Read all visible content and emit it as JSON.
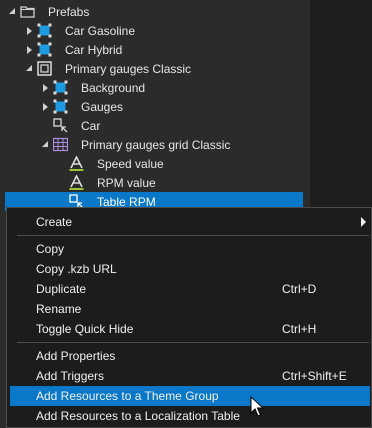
{
  "tree": {
    "items": [
      {
        "label": "Prefabs",
        "icon": "folder-icon",
        "expander": "expanded"
      },
      {
        "label": "Car Gasoline",
        "icon": "prefab-icon",
        "expander": "collapsed"
      },
      {
        "label": "Car Hybrid",
        "icon": "prefab-icon",
        "expander": "collapsed"
      },
      {
        "label": "Primary gauges Classic",
        "icon": "node-icon",
        "expander": "expanded"
      },
      {
        "label": "Background",
        "icon": "prefab-icon",
        "expander": "collapsed"
      },
      {
        "label": "Gauges",
        "icon": "prefab-icon",
        "expander": "collapsed"
      },
      {
        "label": "Car",
        "icon": "prefab-instance-icon",
        "expander": "none"
      },
      {
        "label": "Primary gauges grid Classic",
        "icon": "grid-layout-icon",
        "expander": "expanded"
      },
      {
        "label": "Speed value",
        "icon": "text-block-icon",
        "expander": "none"
      },
      {
        "label": "RPM value",
        "icon": "text-block-icon",
        "expander": "none"
      },
      {
        "label": "Table RPM",
        "icon": "prefab-instance-icon",
        "expander": "none",
        "selected": true
      }
    ]
  },
  "menu": {
    "items": [
      {
        "label": "Create",
        "shortcut": "",
        "submenu": true
      },
      {
        "label": "Copy",
        "shortcut": ""
      },
      {
        "label": "Copy .kzb URL",
        "shortcut": ""
      },
      {
        "label": "Duplicate",
        "shortcut": "Ctrl+D"
      },
      {
        "label": "Rename",
        "shortcut": ""
      },
      {
        "label": "Toggle Quick Hide",
        "shortcut": "Ctrl+H"
      },
      {
        "label": "Add Properties",
        "shortcut": ""
      },
      {
        "label": "Add Triggers",
        "shortcut": "Ctrl+Shift+E"
      },
      {
        "label": "Add Resources to a Theme Group",
        "shortcut": "",
        "highlighted": true
      },
      {
        "label": "Add Resources to a Localization Table",
        "shortcut": ""
      }
    ]
  },
  "colors": {
    "selection": "#0a78c8",
    "background": "#2b2b2b",
    "menu_background": "#1c1c1c",
    "prefab_icon": "#1e9be0",
    "text_icon_underline": "#9bc43a"
  }
}
